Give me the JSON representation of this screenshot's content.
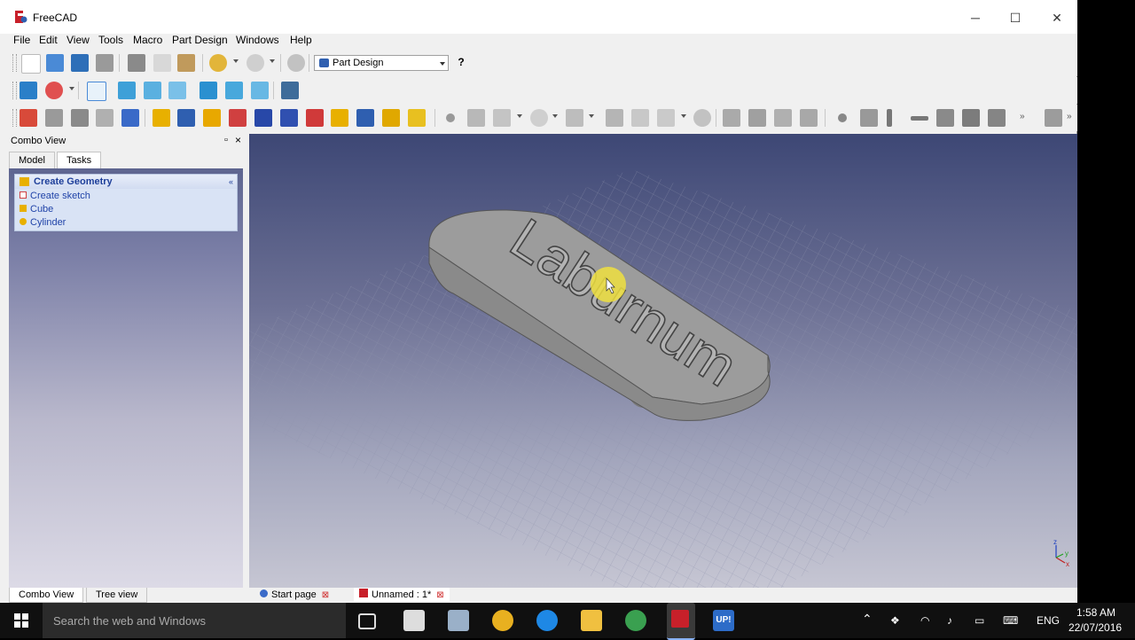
{
  "window": {
    "title": "FreeCAD",
    "minimize": "─",
    "maximize": "☐",
    "close": "✕"
  },
  "menu": [
    "File",
    "Edit",
    "View",
    "Tools",
    "Macro",
    "Part Design",
    "Windows",
    "Help"
  ],
  "toolbar": {
    "workbench": "Part Design",
    "whats_this": "?"
  },
  "combo": {
    "title": "Combo View",
    "tabs": [
      "Model",
      "Tasks"
    ],
    "active_tab": "Tasks",
    "float_btn": "▫",
    "close_btn": "×",
    "task_panel": {
      "title": "Create Geometry",
      "collapse": "«",
      "items": [
        "Create sketch",
        "Cube",
        "Cylinder"
      ]
    },
    "bottom_tabs": [
      "Combo View",
      "Tree view"
    ]
  },
  "viewport": {
    "model_text": "Laburnum",
    "axes": {
      "x": "x",
      "y": "y",
      "z": "z"
    }
  },
  "doc_tabs": [
    {
      "label": "Start page",
      "close": "⊠"
    },
    {
      "label": "Unnamed : 1*",
      "close": "⊠"
    }
  ],
  "taskbar": {
    "search_placeholder": "Search the web and Windows",
    "language": "ENG",
    "time": "1:58 AM",
    "date": "22/07/2016",
    "up_label": "UP!"
  },
  "colors": {
    "viewport_top": "#3d4775",
    "viewport_bottom": "#c6c6d3",
    "task_text": "#2043a8",
    "taskbar": "#101010"
  }
}
